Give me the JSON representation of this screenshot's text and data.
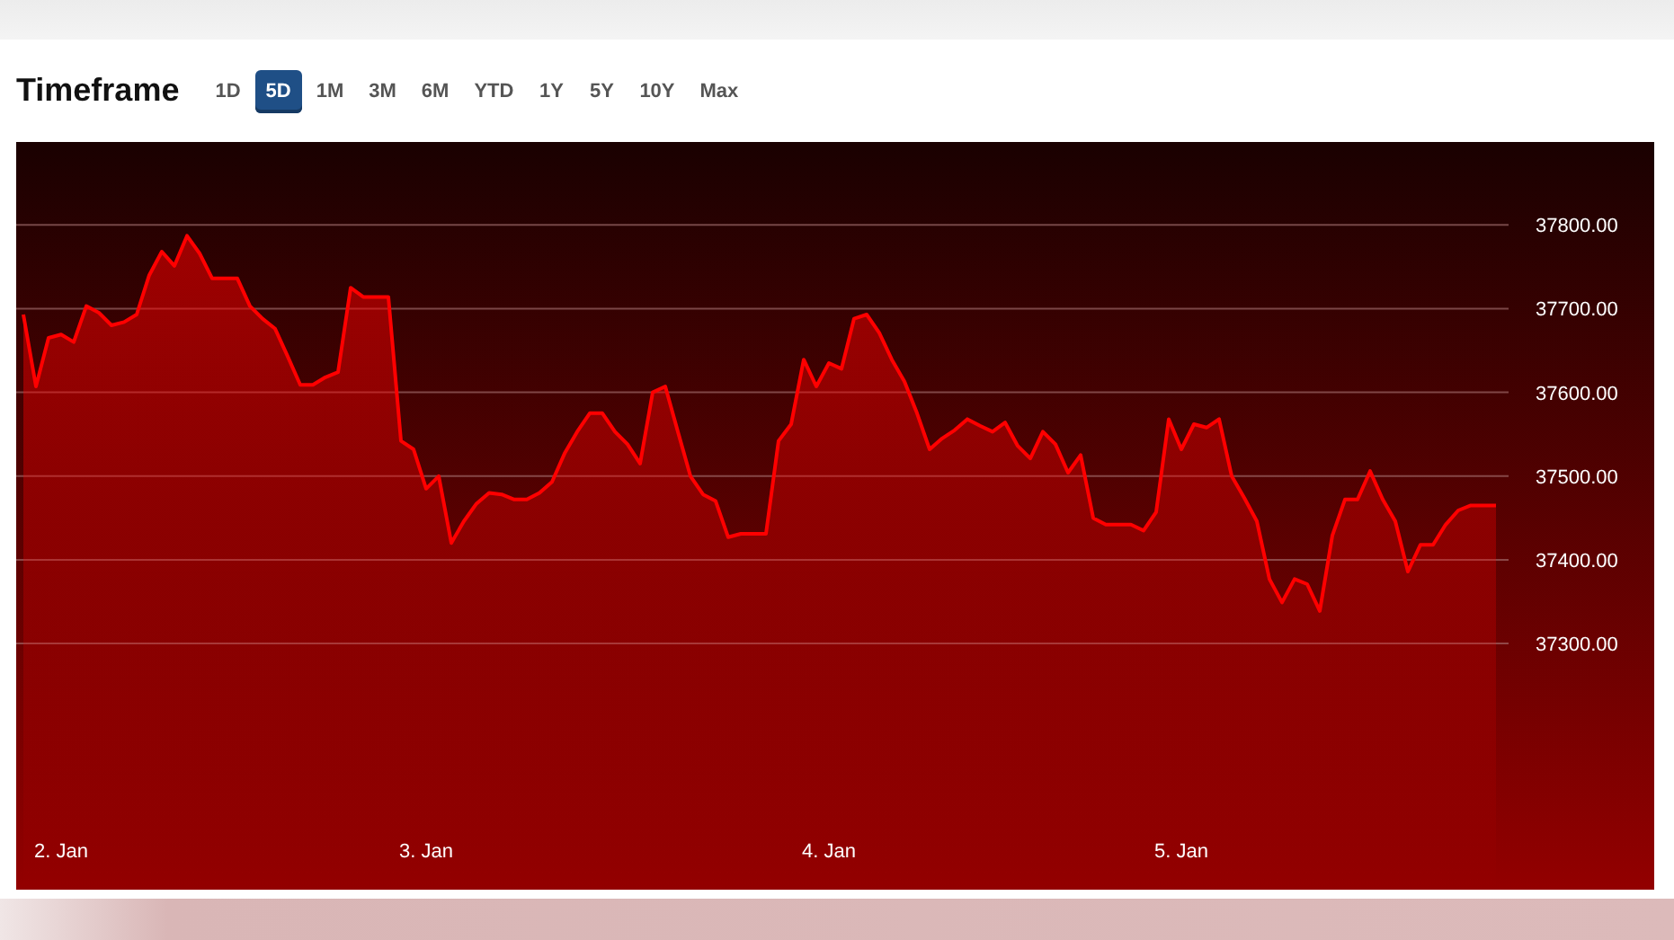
{
  "header": {
    "title": "Timeframe"
  },
  "ranges": [
    {
      "label": "1D",
      "selected": false
    },
    {
      "label": "5D",
      "selected": true
    },
    {
      "label": "1M",
      "selected": false
    },
    {
      "label": "3M",
      "selected": false
    },
    {
      "label": "6M",
      "selected": false
    },
    {
      "label": "YTD",
      "selected": false
    },
    {
      "label": "1Y",
      "selected": false
    },
    {
      "label": "5Y",
      "selected": false
    },
    {
      "label": "10Y",
      "selected": false
    },
    {
      "label": "Max",
      "selected": false
    }
  ],
  "chart": {
    "chart_data": {
      "type": "area",
      "grid": true,
      "ylim": [
        37006,
        37899
      ],
      "categories": [
        null,
        null,
        null,
        "2. Jan",
        null,
        null,
        null,
        null,
        null,
        null,
        null,
        null,
        null,
        null,
        null,
        null,
        null,
        null,
        null,
        null,
        null,
        null,
        null,
        null,
        null,
        null,
        null,
        null,
        null,
        null,
        null,
        null,
        "3. Jan",
        null,
        null,
        null,
        null,
        null,
        null,
        null,
        null,
        null,
        null,
        null,
        null,
        null,
        null,
        null,
        null,
        null,
        null,
        null,
        null,
        null,
        null,
        null,
        null,
        null,
        null,
        null,
        null,
        null,
        null,
        null,
        "4. Jan",
        null,
        null,
        null,
        null,
        null,
        null,
        null,
        null,
        null,
        null,
        null,
        null,
        null,
        null,
        null,
        null,
        null,
        null,
        null,
        null,
        null,
        null,
        null,
        null,
        null,
        null,
        null,
        "5. Jan",
        null,
        null,
        null,
        null,
        null,
        null,
        null,
        null,
        null,
        null,
        null,
        null,
        null,
        null,
        null,
        null,
        null,
        null,
        null,
        null,
        null,
        null,
        null,
        null,
        null
      ],
      "series": [
        {
          "color": "#ff0000",
          "values": [
            37693,
            37607,
            37665,
            37669,
            37660,
            37703,
            37695,
            37680,
            37684,
            37693,
            37740,
            37768,
            37751,
            37787,
            37766,
            37736,
            37736,
            37736,
            37703,
            37688,
            37676,
            37643,
            37609,
            37609,
            37618,
            37624,
            37725,
            37714,
            37714,
            37714,
            37542,
            37532,
            37485,
            37500,
            37420,
            37446,
            37467,
            37480,
            37478,
            37472,
            37472,
            37480,
            37493,
            37527,
            37553,
            37575,
            37575,
            37553,
            37538,
            37515,
            37600,
            37607,
            37553,
            37500,
            37478,
            37470,
            37427,
            37431,
            37431,
            37431,
            37542,
            37562,
            37639,
            37607,
            37635,
            37628,
            37688,
            37693,
            37671,
            37639,
            37613,
            37575,
            37532,
            37545,
            37555,
            37568,
            37560,
            37553,
            37564,
            37536,
            37521,
            37553,
            37538,
            37504,
            37525,
            37450,
            37442,
            37442,
            37442,
            37435,
            37457,
            37568,
            37532,
            37562,
            37558,
            37568,
            37500,
            37474,
            37446,
            37377,
            37349,
            37377,
            37371,
            37339,
            37429,
            37472,
            37472,
            37506,
            37472,
            37446,
            37386,
            37418,
            37418,
            37442,
            37459,
            37465,
            37465,
            37465
          ]
        }
      ],
      "yticks": [
        {
          "value": 37800,
          "label": "37800.00"
        },
        {
          "value": 37700,
          "label": "37700.00"
        },
        {
          "value": 37600,
          "label": "37600.00"
        },
        {
          "value": 37500,
          "label": "37500.00"
        },
        {
          "value": 37400,
          "label": "37400.00"
        },
        {
          "value": 37300,
          "label": "37300.00"
        }
      ]
    }
  }
}
